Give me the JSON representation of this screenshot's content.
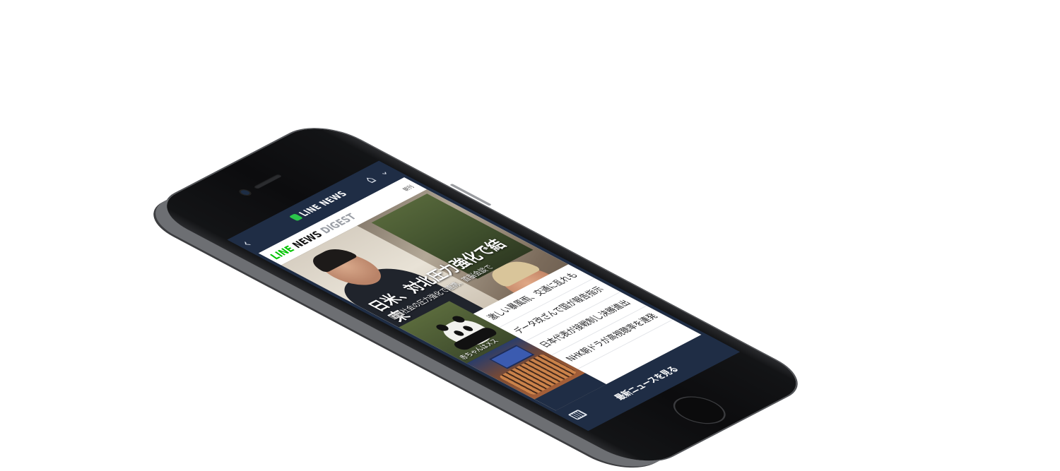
{
  "nav": {
    "back_icon": "chevron-left-icon",
    "brand": "LINE NEWS",
    "home_icon": "home-icon",
    "menu_icon": "chevron-down-icon"
  },
  "digest": {
    "logo_line": "LINE",
    "logo_news": "NEWS",
    "logo_digest": "DIGEST",
    "edition": "朝刊",
    "brand_color": "#00c300"
  },
  "hero": {
    "headline": "日米、対北圧力強化で結束",
    "subline": "国際社会の圧力強化で連携、首脳会談で"
  },
  "thumbnails": [
    {
      "caption": "赤ちゃんはメス"
    }
  ],
  "news": [
    {
      "title": "激しい暴風雨、交通に乱れも"
    },
    {
      "title": "データ改ざんで国が報告指示"
    },
    {
      "title": "日本代表が接戦制し決勝進出"
    },
    {
      "title": "NHK朝ドラが高視聴率を連発"
    }
  ],
  "footer": {
    "keyboard_icon": "keyboard-icon",
    "more_label": "最新ニュースを見る"
  },
  "colors": {
    "chrome": "#1f2d45",
    "accent_green": "#00c300"
  }
}
